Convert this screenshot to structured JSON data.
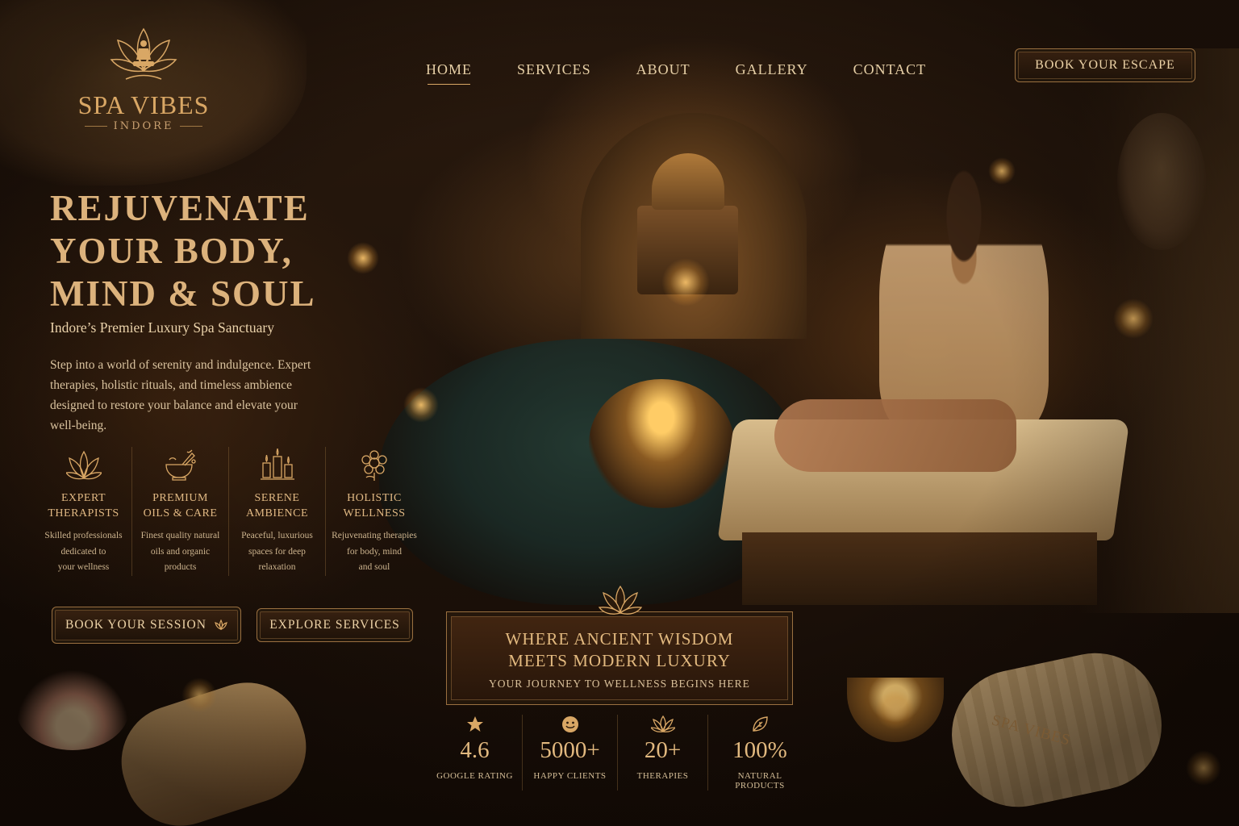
{
  "brand": {
    "name": "SPA VIBES",
    "location": "INDORE",
    "logo_icon": "meditation-lotus-icon"
  },
  "nav": {
    "items": [
      {
        "label": "HOME",
        "active": true
      },
      {
        "label": "SERVICES",
        "active": false
      },
      {
        "label": "ABOUT",
        "active": false
      },
      {
        "label": "GALLERY",
        "active": false
      },
      {
        "label": "CONTACT",
        "active": false
      }
    ],
    "cta_label": "BOOK YOUR ESCAPE"
  },
  "hero": {
    "title_lines": [
      "REJUVENATE",
      "YOUR BODY,",
      "MIND & SOUL"
    ],
    "tagline": "Indore’s Premier Luxury Spa Sanctuary",
    "body": "Step into a world of serenity and indulgence. Expert therapies, holistic rituals, and timeless ambience designed to restore your balance and elevate your well-being."
  },
  "features": [
    {
      "icon": "lotus-icon",
      "title": "EXPERT\nTHERAPISTS",
      "desc": "Skilled professionals\ndedicated to\nyour wellness"
    },
    {
      "icon": "oil-bowl-icon",
      "title": "PREMIUM\nOILS & CARE",
      "desc": "Finest quality natural\noils and organic\nproducts"
    },
    {
      "icon": "candles-icon",
      "title": "SERENE\nAMBIENCE",
      "desc": "Peaceful, luxurious\nspaces for deep\nrelaxation"
    },
    {
      "icon": "holistic-flower-icon",
      "title": "HOLISTIC\nWELLNESS",
      "desc": "Rejuvenating therapies\nfor body, mind\nand soul"
    }
  ],
  "buttons": {
    "session": "BOOK YOUR SESSION",
    "explore": "EXPLORE SERVICES"
  },
  "banner": {
    "line1": "WHERE ANCIENT WISDOM",
    "line2": "MEETS MODERN LUXURY",
    "sub": "YOUR JOURNEY TO WELLNESS BEGINS HERE"
  },
  "stats": [
    {
      "icon": "star-icon",
      "value": "4.6",
      "label": "GOOGLE RATING"
    },
    {
      "icon": "smile-icon",
      "value": "5000+",
      "label": "HAPPY CLIENTS"
    },
    {
      "icon": "lotus-icon",
      "value": "20+",
      "label": "THERAPIES"
    },
    {
      "icon": "leaf-icon",
      "value": "100%",
      "label": "NATURAL PRODUCTS"
    }
  ],
  "towel_text": "SPA VIBES",
  "colors": {
    "accent": "#d9a765",
    "background": "#1a0f08",
    "text": "#e8c79a"
  }
}
